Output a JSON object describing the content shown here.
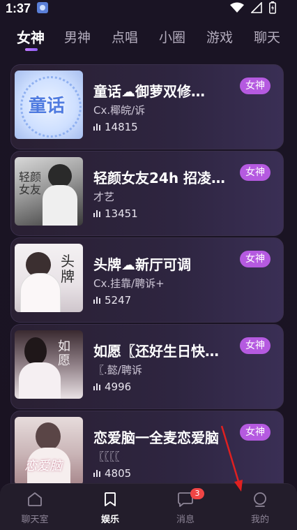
{
  "status_bar": {
    "time": "1:37"
  },
  "tabs": [
    {
      "label": "女神",
      "active": true
    },
    {
      "label": "男神",
      "active": false
    },
    {
      "label": "点唱",
      "active": false
    },
    {
      "label": "小圈",
      "active": false
    },
    {
      "label": "游戏",
      "active": false
    },
    {
      "label": "聊天",
      "active": false
    }
  ],
  "rooms": [
    {
      "title": "童话☁御萝双修…",
      "host": "Cx.椰皖/诉",
      "count": "14815",
      "badge": "女神",
      "cover_text": "童话"
    },
    {
      "title": "轻颜女友24h 招凌…",
      "host": "才艺",
      "count": "13451",
      "badge": "女神",
      "cover_text": "轻颜女友"
    },
    {
      "title": "头牌☁新厅可调",
      "host": "Cx.挂靠/聘诉+",
      "count": "5247",
      "badge": "女神",
      "cover_text": "头牌"
    },
    {
      "title": "如愿〖还好生日快…",
      "host": "〖.懿/聘诉",
      "count": "4996",
      "badge": "女神",
      "cover_text": "如愿"
    },
    {
      "title": "恋爱脑一全麦恋爱脑",
      "host": "〖〖〖〖",
      "count": "4805",
      "badge": "女神",
      "cover_text": "恋爱脑"
    }
  ],
  "bottom_nav": [
    {
      "label": "聊天室",
      "icon": "home-icon",
      "active": false
    },
    {
      "label": "娱乐",
      "icon": "bookmark-icon",
      "active": true
    },
    {
      "label": "消息",
      "icon": "chat-icon",
      "active": false,
      "badge": "3"
    },
    {
      "label": "我的",
      "icon": "profile-icon",
      "active": false
    }
  ],
  "colors": {
    "accent": "#b55ae0",
    "background": "#1a1424",
    "nav_bg": "#231d2b",
    "badge_red": "#f04545",
    "arrow": "#e02020"
  }
}
